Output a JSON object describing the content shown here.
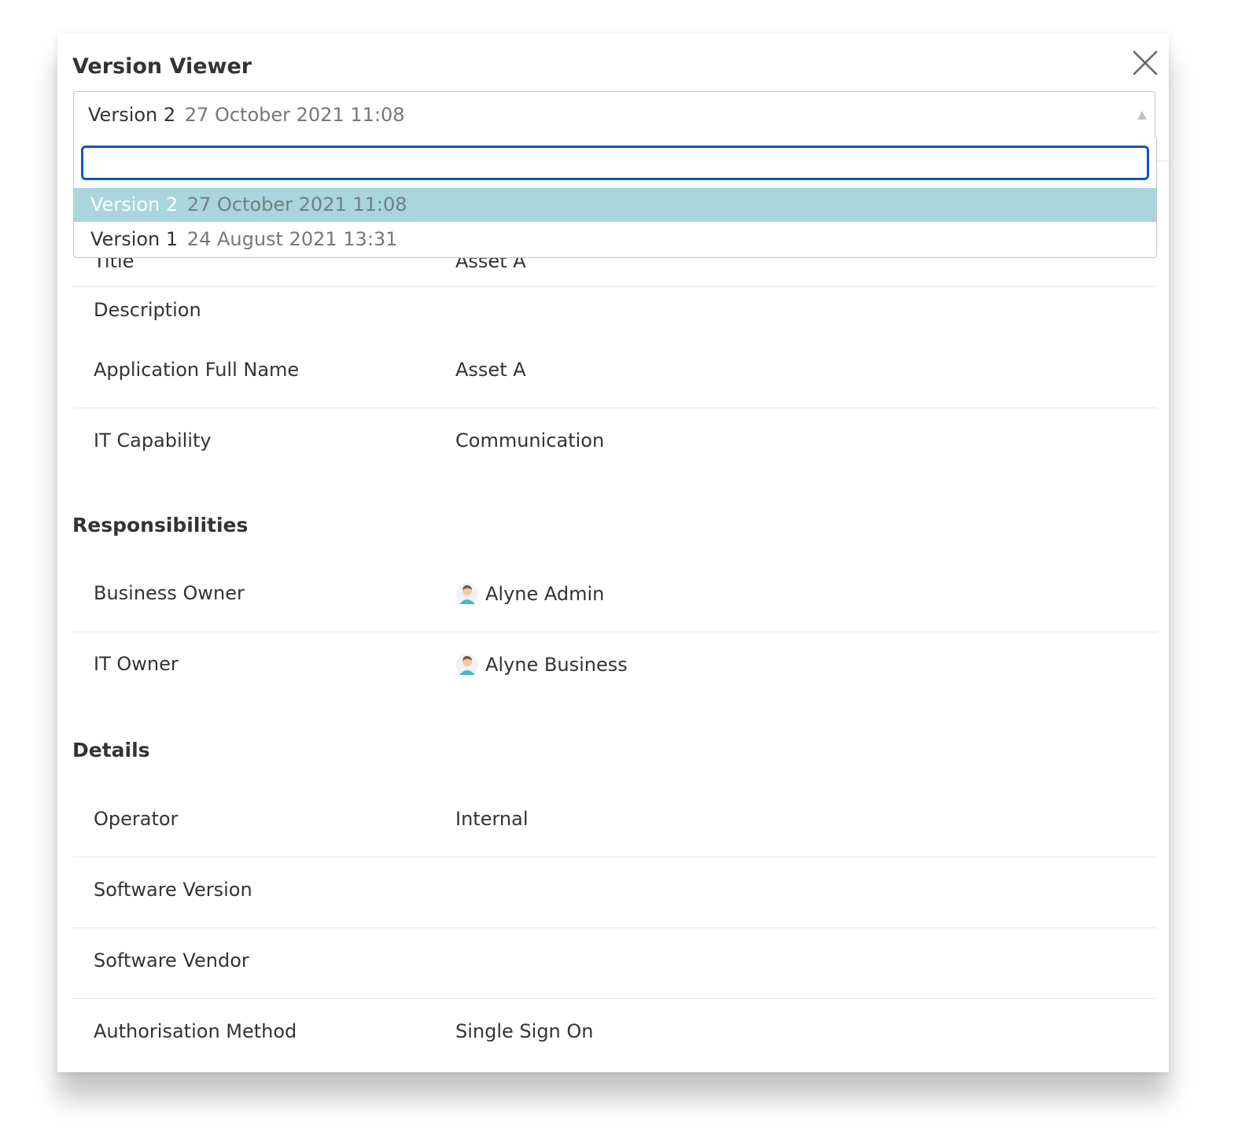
{
  "modal": {
    "title": "Version Viewer",
    "close_icon": "close-icon"
  },
  "version_select": {
    "selected_name": "Version 2",
    "selected_date": "27 October 2021 11:08",
    "search_value": "",
    "options": [
      {
        "name": "Version 2",
        "date": "27 October 2021 11:08",
        "selected": true
      },
      {
        "name": "Version 1",
        "date": "24 August 2021 13:31",
        "selected": false
      }
    ]
  },
  "general": {
    "rows": [
      {
        "label": "Title",
        "value": "Asset A"
      },
      {
        "label": "Description",
        "value": ""
      },
      {
        "label": "Application Full Name",
        "value": "Asset A"
      },
      {
        "label": "IT Capability",
        "value": "Communication"
      }
    ]
  },
  "responsibilities": {
    "title": "Responsibilities",
    "rows": [
      {
        "label": "Business Owner",
        "value": "Alyne Admin",
        "icon": "user-avatar-icon"
      },
      {
        "label": "IT Owner",
        "value": "Alyne Business",
        "icon": "user-avatar-icon"
      }
    ]
  },
  "details": {
    "title": "Details",
    "rows": [
      {
        "label": "Operator",
        "value": "Internal"
      },
      {
        "label": "Software Version",
        "value": ""
      },
      {
        "label": "Software Vendor",
        "value": ""
      },
      {
        "label": "Authorisation Method",
        "value": "Single Sign On"
      }
    ]
  },
  "colors": {
    "selected_option_bg": "#a8d6dc",
    "search_focus_border": "#0a55c8",
    "text": "#333333",
    "muted_text": "#777777"
  }
}
